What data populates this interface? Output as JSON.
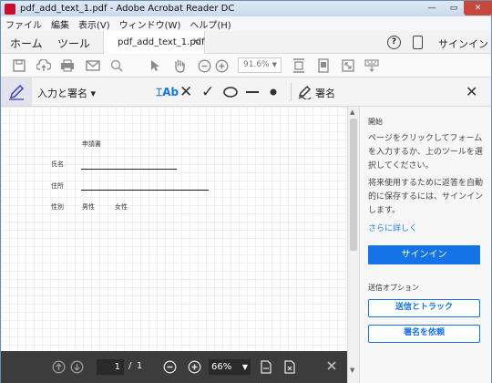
{
  "window": {
    "title": "pdf_add_text_1.pdf - Adobe Acrobat Reader DC",
    "min_glyph": "—",
    "max_glyph": "▭",
    "close_glyph": "✕"
  },
  "menu": [
    "ファイル",
    "編集",
    "表示(V)",
    "ウィンドウ(W)",
    "ヘルプ(H)"
  ],
  "tabs": {
    "home": "ホーム",
    "tools": "ツール",
    "document": "pdf_add_text_1.pdf",
    "close_glyph": "×",
    "help_glyph": "?",
    "signin": "サインイン"
  },
  "toolbar": {
    "zoom": "91.6%",
    "icons": [
      "save-icon",
      "upload-icon",
      "print-icon",
      "email-icon",
      "search-icon",
      "select-icon",
      "hand-icon",
      "zoom-out-icon",
      "zoom-in-icon",
      "fit-page-icon",
      "page-view-icon",
      "fullscreen-icon",
      "keyboard-icon"
    ]
  },
  "signbar": {
    "mode_label": "入力と署名",
    "text_tool_label": "Ab",
    "sign_label": "署名"
  },
  "document": {
    "heading": "申請書",
    "name_label": "氏名",
    "address_label": "住所",
    "gender_label": "性別",
    "male_label": "男性",
    "female_label": "女性"
  },
  "pagebar": {
    "current_page": "1",
    "separator": "/",
    "total_pages": "1",
    "zoom": "66%"
  },
  "panel": {
    "title": "開始",
    "description": "ページをクリックしてフォームを入力するか、上のツールを選択してください。",
    "signin_note": "将来使用するために返答を自動的に保存するには、サインインします。",
    "learn_more": "さらに詳しく",
    "signin_button": "サインイン",
    "send_options_title": "送信オプション",
    "send_track_button": "送信とトラック",
    "request_sign_button": "署名を依頼"
  },
  "colors": {
    "accent": "#1473e6",
    "link": "#2680eb",
    "pagebar_bg": "#3c3c3c",
    "close_button": "#c8473c"
  }
}
